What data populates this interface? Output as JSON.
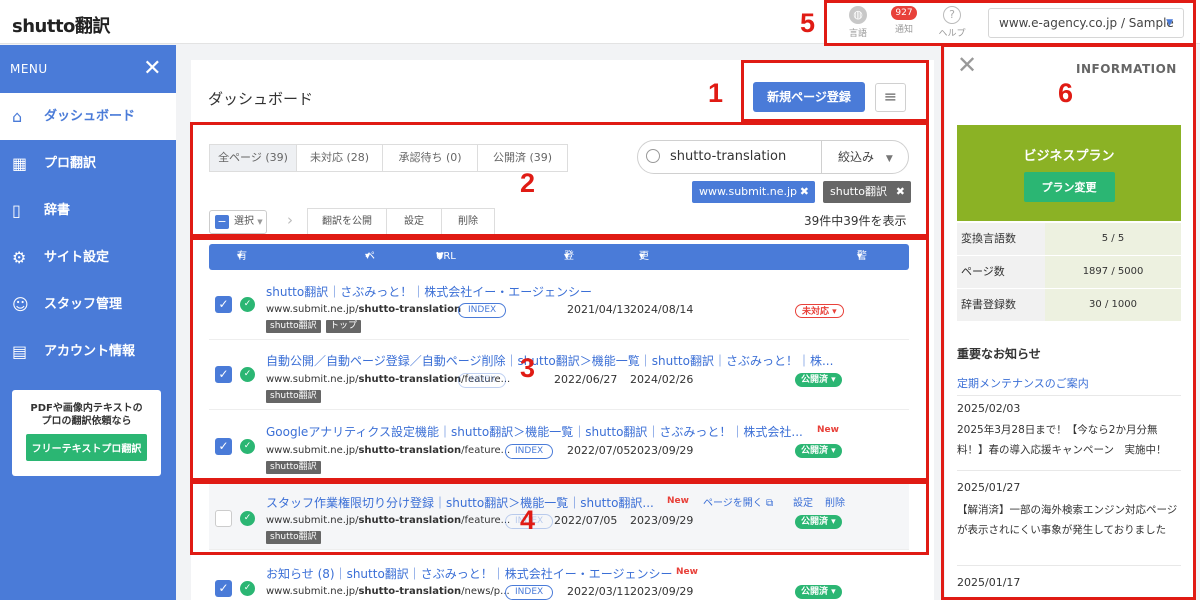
{
  "topbar": {
    "logo": "shutto翻訳",
    "language_label": "言語",
    "notification_count": "927",
    "notification_label": "通知",
    "help_label": "ヘルプ",
    "site_select": "www.e-agency.co.jp / Sample"
  },
  "sidebar": {
    "menu_label": "MENU",
    "items": [
      {
        "label": "ダッシュボード",
        "icon": "home-icon"
      },
      {
        "label": "プロ翻訳",
        "icon": "calendar-icon"
      },
      {
        "label": "辞書",
        "icon": "book-icon"
      },
      {
        "label": "サイト設定",
        "icon": "gear-icon"
      },
      {
        "label": "スタッフ管理",
        "icon": "users-icon"
      },
      {
        "label": "アカウント情報",
        "icon": "document-icon"
      }
    ],
    "promo_line1": "PDFや画像内テキストの",
    "promo_line2": "プロの翻訳依頼なら",
    "promo_button": "フリーテキストプロ翻訳"
  },
  "main": {
    "title": "ダッシュボード",
    "new_page_button": "新規ページ登録",
    "filter_tabs": [
      "全ページ (39)",
      "未対応 (28)",
      "承認待ち (0)",
      "公開済 (39)"
    ],
    "search_value": "shutto-translation",
    "refine_label": "絞込み",
    "tags": [
      "www.submit.ne.jp",
      "shutto翻訳"
    ],
    "select_label": "選択",
    "actions": [
      "翻訳を公開",
      "設定",
      "削除"
    ],
    "count_text": "39件中39件を表示",
    "columns": {
      "enabled": "有効",
      "page_name": "ページ名",
      "url": "URL",
      "registered": "登録日",
      "updated": "更新日",
      "warning": "警告"
    },
    "rows": [
      {
        "title": "shutto翻訳｜さぶみっと！｜株式会社イー・エージェンシー",
        "url_prefix": "www.submit.ne.jp/",
        "url_bold": "shutto-translation",
        "index": "INDEX",
        "registered": "2021/04/13",
        "updated": "2024/08/14",
        "tags": [
          "shutto翻訳",
          "トップ"
        ],
        "status": "未対応",
        "checked": true,
        "new": ""
      },
      {
        "title": "自動公開／自動ページ登録／自動ページ削除｜shutto翻訳＞機能一覧｜shutto翻訳｜さぶみっと！｜株...",
        "url_prefix": "www.submit.ne.jp/",
        "url_bold": "shutto-translation",
        "url_suffix": "/feature...",
        "index": "INDEX",
        "registered": "2022/06/27",
        "updated": "2024/02/26",
        "tags": [
          "shutto翻訳"
        ],
        "status": "公開済",
        "checked": true,
        "new": ""
      },
      {
        "title": "Googleアナリティクス設定機能｜shutto翻訳＞機能一覧｜shutto翻訳｜さぶみっと！｜株式会社...",
        "url_prefix": "www.submit.ne.jp/",
        "url_bold": "shutto-translation",
        "url_suffix": "/feature...",
        "index": "INDEX",
        "registered": "2022/07/05",
        "updated": "2023/09/29",
        "tags": [
          "shutto翻訳"
        ],
        "status": "公開済",
        "checked": true,
        "new": "New"
      },
      {
        "title": "スタッフ作業権限切り分け登録｜shutto翻訳＞機能一覧｜shutto翻訳...",
        "url_prefix": "www.submit.ne.jp/",
        "url_bold": "shutto-translation",
        "url_suffix": "/feature...",
        "index": "INDEX",
        "registered": "2022/07/05",
        "updated": "2023/09/29",
        "tags": [
          "shutto翻訳"
        ],
        "status": "公開済",
        "checked": false,
        "new": "New",
        "open_label": "ページを開く",
        "settings_label": "設定",
        "delete_label": "削除"
      },
      {
        "title": "お知らせ (8)｜shutto翻訳｜さぶみっと！｜株式会社イー・エージェンシー",
        "url_prefix": "www.submit.ne.jp/",
        "url_bold": "shutto-translation",
        "url_suffix": "/news/p...",
        "index": "INDEX",
        "registered": "2022/03/11",
        "updated": "2023/09/29",
        "tags": [],
        "status": "公開済",
        "checked": true,
        "new": "New"
      }
    ]
  },
  "info": {
    "title": "INFORMATION",
    "plan_name": "ビジネスプラン",
    "plan_button": "プラン変更",
    "stats": [
      {
        "key": "変換言語数",
        "value": "5 / 5"
      },
      {
        "key": "ページ数",
        "value": "1897 / 5000"
      },
      {
        "key": "辞書登録数",
        "value": "30 / 1000"
      }
    ],
    "news_header": "重要なお知らせ",
    "news_link": "定期メンテナンスのご案内",
    "news": [
      {
        "date": "2025/02/03",
        "text": "2025年3月28日まで！【今なら2か月分無料！】春の導入応援キャンペーン　実施中！"
      },
      {
        "date": "2025/01/27",
        "text": "【解消済】一部の海外検索エンジン対応ページが表示されにくい事象が発生しておりました"
      },
      {
        "date": "2025/01/17",
        "text": ""
      }
    ]
  },
  "callouts": [
    "1",
    "2",
    "3",
    "4",
    "5",
    "6"
  ],
  "colors": {
    "primary": "#4a7bd8",
    "success": "#2bb673",
    "danger": "#e8413a",
    "plan": "#8bb225",
    "callout": "#e01b14"
  }
}
